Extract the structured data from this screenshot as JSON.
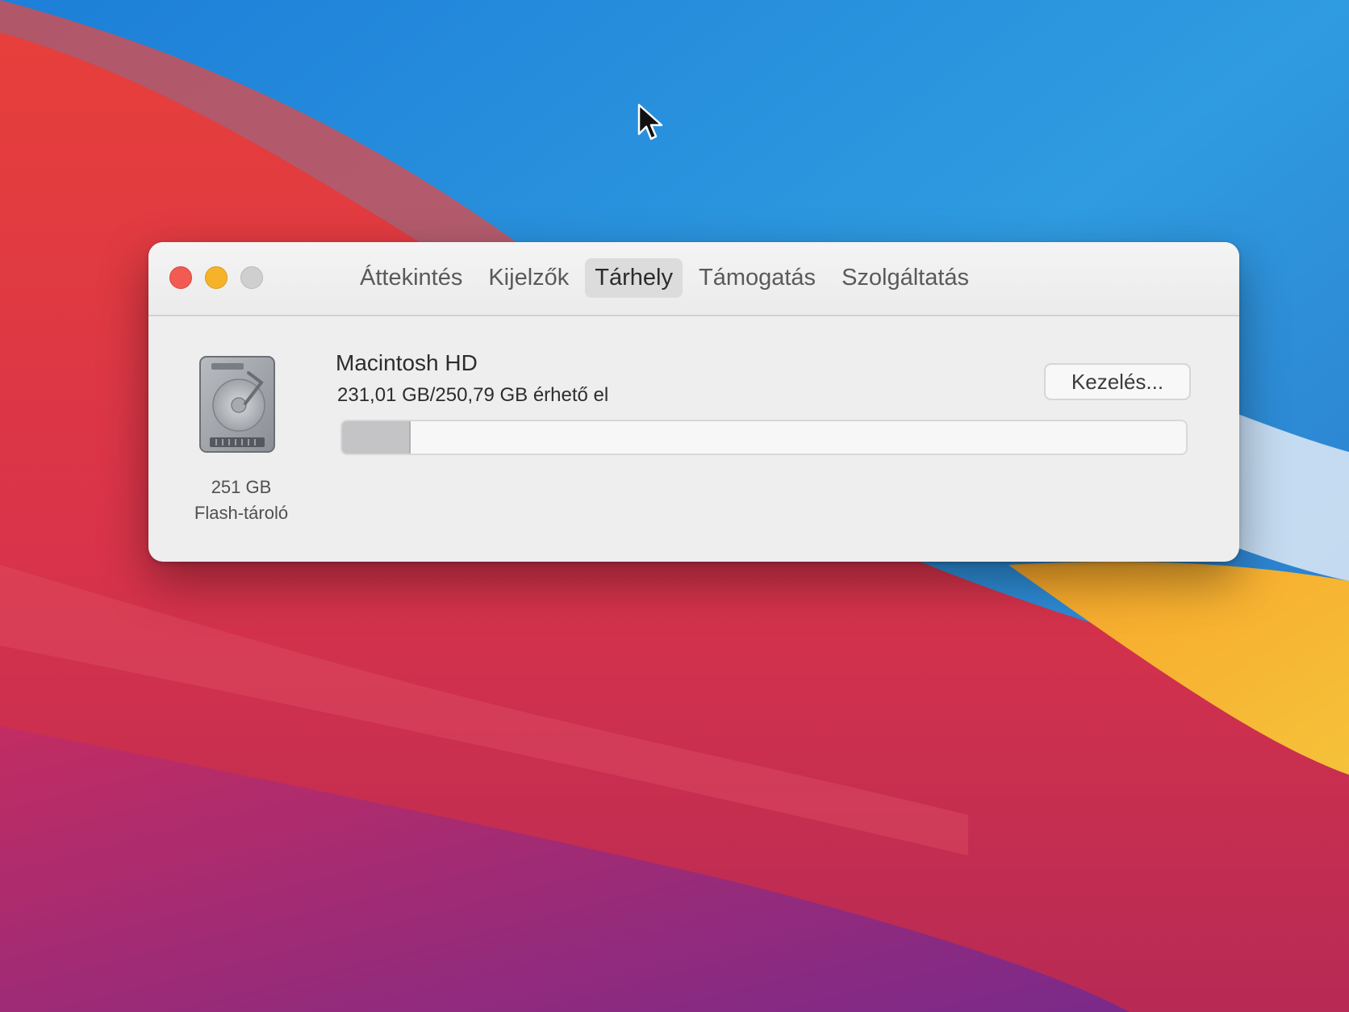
{
  "window": {
    "tabs": [
      {
        "label": "Áttekintés",
        "active": false
      },
      {
        "label": "Kijelzők",
        "active": false
      },
      {
        "label": "Tárhely",
        "active": true
      },
      {
        "label": "Támogatás",
        "active": false
      },
      {
        "label": "Szolgáltatás",
        "active": false
      }
    ]
  },
  "storage": {
    "disk_size": "251 GB",
    "disk_type": "Flash-tároló",
    "volume_name": "Macintosh HD",
    "available_text": "231,01 GB/250,79 GB érhető el",
    "used_fraction": 0.079,
    "manage_label": "Kezelés..."
  },
  "icons": {
    "disk": "hard-drive-icon",
    "cursor": "mouse-pointer-icon"
  },
  "colors": {
    "close": "#f35b52",
    "minimize": "#f6b32a",
    "zoom": "#cfcfcf"
  }
}
